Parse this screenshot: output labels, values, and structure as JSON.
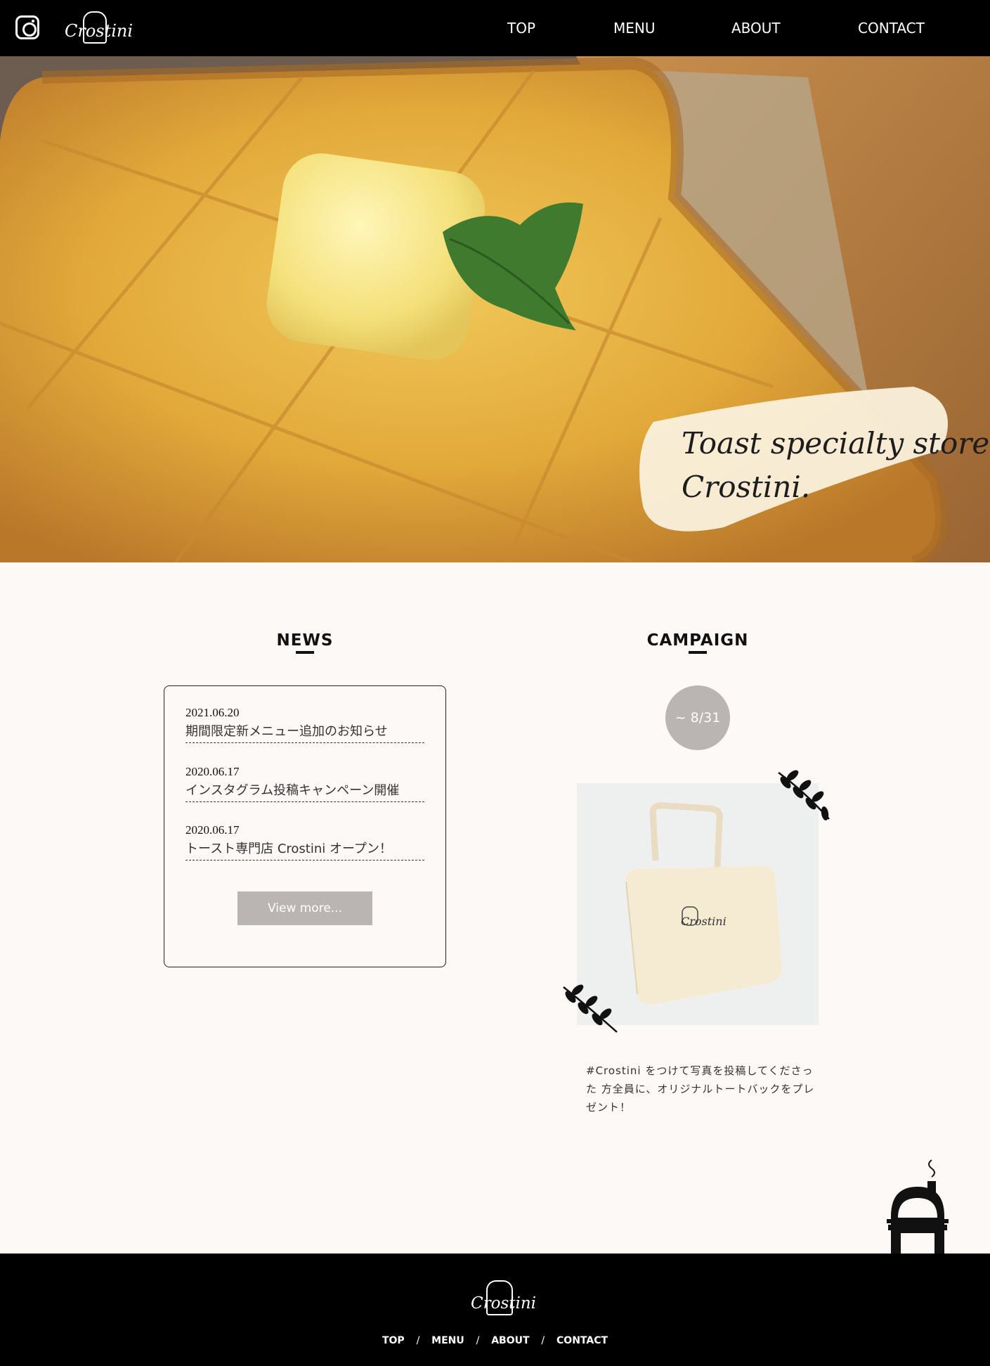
{
  "header": {
    "brand": "Crostini",
    "nav": [
      "TOP",
      "MENU",
      "ABOUT",
      "CONTACT"
    ]
  },
  "hero": {
    "tagline_line1": "Toast specialty store",
    "tagline_line2": "Crostini."
  },
  "news": {
    "title": "NEWS",
    "items": [
      {
        "date": "2021.06.20",
        "text": "期間限定新メニュー追加のお知らせ"
      },
      {
        "date": "2020.06.17",
        "text": "インスタグラム投稿キャンペーン開催"
      },
      {
        "date": "2020.06.17",
        "text": "トースト専門店 Crostini オープン！"
      }
    ],
    "view_more": "View more..."
  },
  "campaign": {
    "title": "CAMPAIGN",
    "badge": "~ 8/31",
    "bag_brand": "Crostini",
    "text": "#Crostini をつけて写真を投稿してくださった 方全員に、オリジナルトートバックをプレゼント！"
  },
  "footer": {
    "brand": "Crostini",
    "nav": [
      "TOP",
      "MENU",
      "ABOUT",
      "CONTACT"
    ],
    "separator": "/"
  },
  "icons": [
    "instagram-icon",
    "leaf-icon",
    "oven-icon",
    "bread-logo-icon"
  ],
  "colors": {
    "header_bg": "#000000",
    "page_bg": "#fcf9f7",
    "accent_grey": "#bab4b2"
  }
}
